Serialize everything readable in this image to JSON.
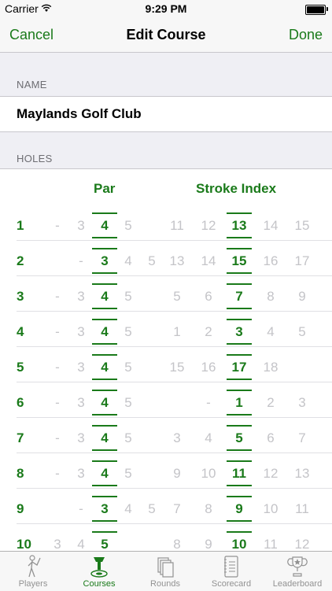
{
  "status": {
    "carrier": "Carrier",
    "time": "9:29 PM"
  },
  "nav": {
    "cancel": "Cancel",
    "title": "Edit Course",
    "done": "Done"
  },
  "sections": {
    "name_header": "NAME",
    "holes_header": "HOLES"
  },
  "course": {
    "name": "Maylands Golf Club"
  },
  "columns": {
    "par": "Par",
    "stroke_index": "Stroke Index"
  },
  "holes": [
    {
      "num": "1",
      "par": [
        "-",
        "3",
        "4",
        "5",
        ""
      ],
      "si": [
        "11",
        "12",
        "13",
        "14",
        "15"
      ]
    },
    {
      "num": "2",
      "par": [
        "",
        "-",
        "3",
        "4",
        "5"
      ],
      "si": [
        "13",
        "14",
        "15",
        "16",
        "17"
      ]
    },
    {
      "num": "3",
      "par": [
        "-",
        "3",
        "4",
        "5",
        ""
      ],
      "si": [
        "5",
        "6",
        "7",
        "8",
        "9"
      ]
    },
    {
      "num": "4",
      "par": [
        "-",
        "3",
        "4",
        "5",
        ""
      ],
      "si": [
        "1",
        "2",
        "3",
        "4",
        "5"
      ]
    },
    {
      "num": "5",
      "par": [
        "-",
        "3",
        "4",
        "5",
        ""
      ],
      "si": [
        "15",
        "16",
        "17",
        "18",
        ""
      ]
    },
    {
      "num": "6",
      "par": [
        "-",
        "3",
        "4",
        "5",
        ""
      ],
      "si": [
        "",
        "-",
        "1",
        "2",
        "3"
      ]
    },
    {
      "num": "7",
      "par": [
        "-",
        "3",
        "4",
        "5",
        ""
      ],
      "si": [
        "3",
        "4",
        "5",
        "6",
        "7"
      ]
    },
    {
      "num": "8",
      "par": [
        "-",
        "3",
        "4",
        "5",
        ""
      ],
      "si": [
        "9",
        "10",
        "11",
        "12",
        "13"
      ]
    },
    {
      "num": "9",
      "par": [
        "",
        "-",
        "3",
        "4",
        "5"
      ],
      "si": [
        "7",
        "8",
        "9",
        "10",
        "11"
      ]
    },
    {
      "num": "10",
      "par": [
        "3",
        "4",
        "5",
        "",
        ""
      ],
      "si": [
        "8",
        "9",
        "10",
        "11",
        "12"
      ]
    }
  ],
  "tabs": [
    {
      "label": "Players",
      "icon": "golfer-icon"
    },
    {
      "label": "Courses",
      "icon": "tee-icon"
    },
    {
      "label": "Rounds",
      "icon": "cards-icon"
    },
    {
      "label": "Scorecard",
      "icon": "notebook-icon"
    },
    {
      "label": "Leaderboard",
      "icon": "trophy-icon"
    }
  ],
  "colors": {
    "accent": "#1a7a1a",
    "inactive": "#c4c4c8",
    "background": "#efeff4"
  }
}
